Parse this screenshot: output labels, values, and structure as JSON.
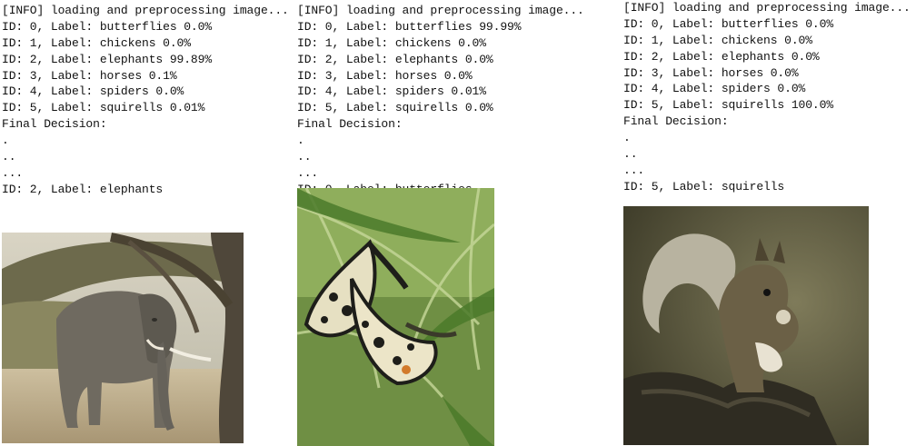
{
  "panels": [
    {
      "lines": [
        "[INFO] loading and preprocessing image...",
        "ID: 0, Label: butterflies 0.0%",
        "ID: 1, Label: chickens 0.0%",
        "ID: 2, Label: elephants 99.89%",
        "ID: 3, Label: horses 0.1%",
        "ID: 4, Label: spiders 0.0%",
        "ID: 5, Label: squirells 0.01%",
        "Final Decision:",
        ".",
        "..",
        "...",
        "ID: 2, Label: elephants"
      ],
      "image_subject": "elephant"
    },
    {
      "lines": [
        "[INFO] loading and preprocessing image...",
        "ID: 0, Label: butterflies 99.99%",
        "ID: 1, Label: chickens 0.0%",
        "ID: 2, Label: elephants 0.0%",
        "ID: 3, Label: horses 0.0%",
        "ID: 4, Label: spiders 0.01%",
        "ID: 5, Label: squirells 0.0%",
        "Final Decision:",
        ".",
        "..",
        "...",
        "ID: 0, Label: butterflies"
      ],
      "image_subject": "butterflies"
    },
    {
      "lines": [
        "[INFO] loading and preprocessing image...",
        "ID: 0, Label: butterflies 0.0%",
        "ID: 1, Label: chickens 0.0%",
        "ID: 2, Label: elephants 0.0%",
        "ID: 3, Label: horses 0.0%",
        "ID: 4, Label: spiders 0.0%",
        "ID: 5, Label: squirells 100.0%",
        "Final Decision:",
        ".",
        "..",
        "...",
        "ID: 5, Label: squirells"
      ],
      "image_subject": "squirrel"
    }
  ]
}
